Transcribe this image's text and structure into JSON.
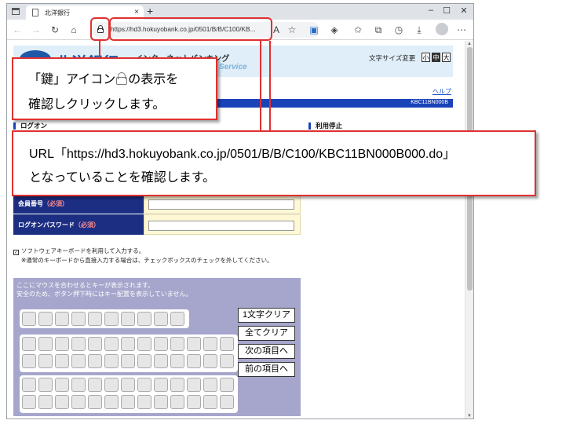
{
  "browser": {
    "tab_title": "北洋銀行",
    "tab_close": "×",
    "new_tab": "+",
    "url": "https://hd3.hokuyobank.co.jp/0501/B/B/C100/KB..."
  },
  "page": {
    "bank_name": "北洋銀行",
    "ib_title": "インターネットバンキング",
    "ib_subtitle": "Service",
    "font_size_label": "文字サイズ変更",
    "font_size_buttons": [
      "小",
      "中",
      "大"
    ],
    "help_link": "ヘルプ",
    "screen_code": "KBC11BN000B",
    "section_logon": "ログオン",
    "section_stop": "利用停止",
    "fields": [
      {
        "label": "会員番号",
        "required": "（必須）"
      },
      {
        "label": "ログオンパスワード",
        "required": "（必須）"
      }
    ],
    "software_keyboard_check": "ソフトウェアキーボードを利用して入力する。",
    "software_keyboard_checkmark": "✓",
    "software_keyboard_note": "※通常のキーボードから直接入力する場合は、チェックボックスのチェックを外してください。",
    "keyboard_msg_1": "ここにマウスを合わせるとキーが表示されます。",
    "keyboard_msg_2": "安全のため、ボタン押下時にはキー配置を表示していません。",
    "keyboard_buttons": [
      "1文字クリア",
      "全てクリア",
      "次の項目へ",
      "前の項目へ"
    ]
  },
  "callouts": {
    "lock": {
      "line1_before": "「鍵」アイコン",
      "line1_after": "の表示を",
      "line2": "確認しクリックします。"
    },
    "url": {
      "line1": "URL「https://hd3.hokuyobank.co.jp/0501/B/B/C100/KBC11BN000B000.do」",
      "line2": "となっていることを確認します。"
    }
  },
  "colors": {
    "highlight": "#e03030",
    "title_bar": "#1a43b8",
    "form_label": "#1c2e82",
    "keyboard_bg": "#a6a6cd"
  }
}
